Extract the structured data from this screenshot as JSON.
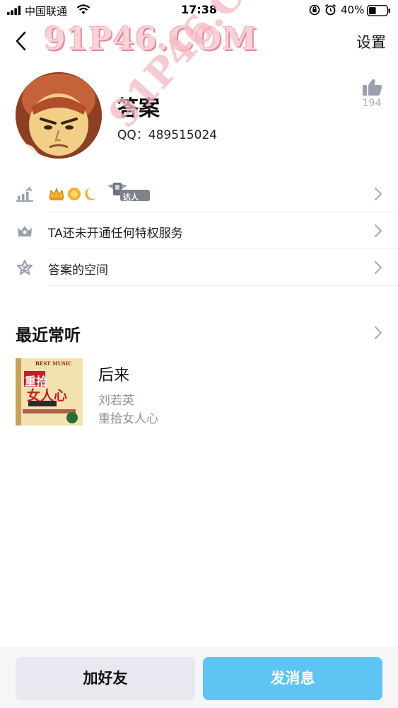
{
  "status_bar": {
    "carrier": "中国联通",
    "time": "17:38",
    "battery_percent": "40%",
    "battery_level": 0.4,
    "icons": [
      "signal-icon",
      "wifi-icon",
      "rotation-lock-icon",
      "alarm-icon",
      "battery-icon"
    ]
  },
  "nav": {
    "back_icon": "chevron-left-icon",
    "settings_label": "设置"
  },
  "watermark": {
    "text": "91P46.COM",
    "diagonal_text": "91P46.COM"
  },
  "profile": {
    "name": "答案",
    "qq_label": "QQ：",
    "qq_number": "489515024",
    "like_icon": "thumbs-up-icon",
    "like_count": "194"
  },
  "rows": {
    "level": {
      "icon": "level-up-icon",
      "badges": [
        "crown-icon",
        "sun-icon",
        "moon-icon"
      ],
      "talent_badge": "达人"
    },
    "service": {
      "icon": "crown-outline-icon",
      "label": "TA还未开通任何特权服务"
    },
    "space": {
      "icon": "star-z-icon",
      "label": "答案的空间"
    }
  },
  "recent": {
    "title": "最近常听",
    "song": {
      "title": "后来",
      "artist": "刘若英",
      "album": "重拾女人心",
      "cover_text_top": "BEST MUSIC",
      "cover_title": "重拾",
      "cover_subtitle": "女人心"
    }
  },
  "actions": {
    "add_friend": "加好友",
    "send_message": "发消息"
  },
  "colors": {
    "accent_blue": "#5dc4f4",
    "secondary_button": "#e8e8f0",
    "muted_text": "#8e929c",
    "icon_gray": "#9aa0ad"
  }
}
